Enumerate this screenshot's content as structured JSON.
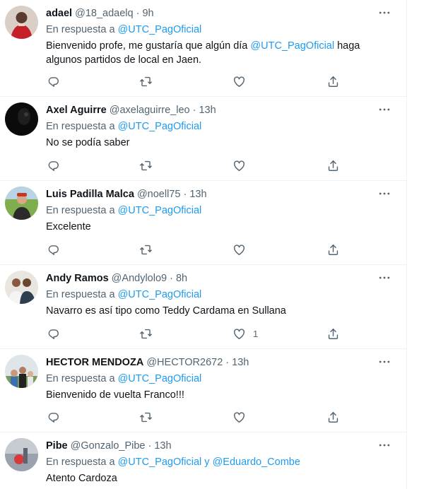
{
  "reply_prefix": "En respuesta a",
  "tweets": [
    {
      "name": "adael",
      "handle": "@18_adaelq",
      "time": "9h",
      "reply_to": "@UTC_PagOficial",
      "text_pre": "Bienvenido profe, me gustaría que algún día ",
      "text_mention": "@UTC_PagOficial",
      "text_post": " haga algunos partidos de local en Jaen.",
      "like_count": ""
    },
    {
      "name": "Axel Aguirre",
      "handle": "@axelaguirre_leo",
      "time": "13h",
      "reply_to": "@UTC_PagOficial",
      "text": "No se podía saber",
      "like_count": ""
    },
    {
      "name": "Luis Padilla Malca",
      "handle": "@noell75",
      "time": "13h",
      "reply_to": "@UTC_PagOficial",
      "text": "Excelente",
      "like_count": ""
    },
    {
      "name": "Andy Ramos",
      "handle": "@Andylolo9",
      "time": "8h",
      "reply_to": "@UTC_PagOficial",
      "text": "Navarro es así tipo como Teddy Cardama en Sullana",
      "like_count": "1"
    },
    {
      "name": "HECTOR MENDOZA",
      "handle": "@HECTOR2672",
      "time": "13h",
      "reply_to": "@UTC_PagOficial",
      "text": "Bienvenido de vuelta Franco!!!",
      "like_count": ""
    },
    {
      "name": "Pibe",
      "handle": "@Gonzalo_Pibe",
      "time": "13h",
      "reply_to": "@UTC_PagOficial",
      "reply_joiner": " y ",
      "reply_to_2": "@Eduardo_Combe",
      "text": "Atento Cardoza",
      "like_count": ""
    }
  ],
  "separator": " · ",
  "icons": {
    "more": "more-horizontal-icon",
    "reply": "reply-icon",
    "retweet": "retweet-icon",
    "like": "heart-icon",
    "share": "share-icon"
  },
  "colors": {
    "link": "#1d9bf0",
    "secondary": "#536471",
    "primary_text": "#0f1419"
  }
}
